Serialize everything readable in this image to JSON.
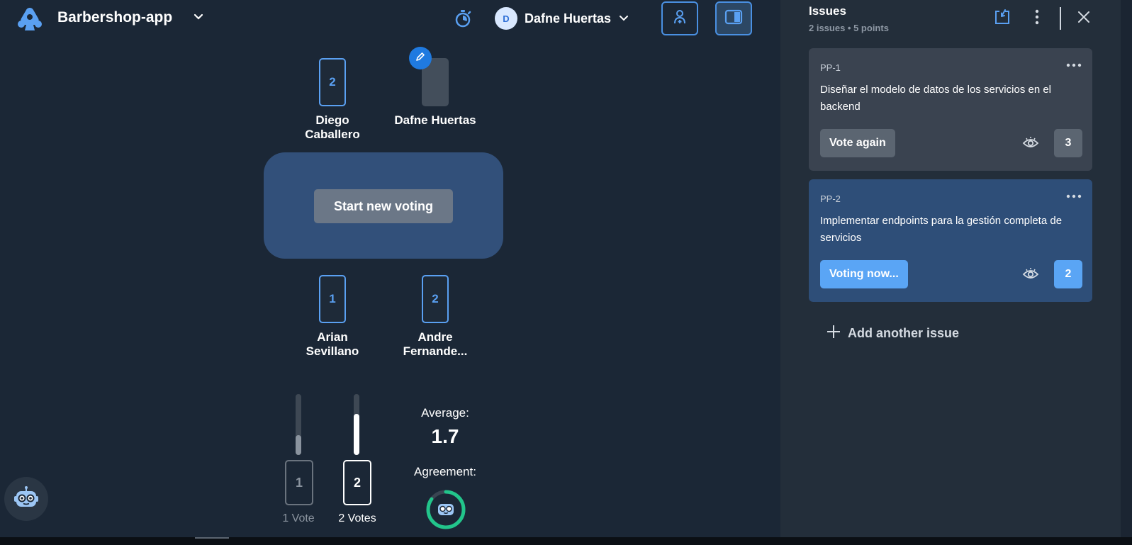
{
  "header": {
    "app_title": "Barbershop-app",
    "user_initial": "D",
    "user_name": "Dafne Huertas"
  },
  "table": {
    "start_label": "Start new voting",
    "players": [
      {
        "name": "Diego Caballero",
        "card": "2",
        "state": "voted"
      },
      {
        "name": "Dafne Huertas",
        "card": "",
        "state": "blank"
      },
      {
        "name": "Arian Sevillano",
        "card": "1",
        "state": "voted"
      },
      {
        "name": "Andre Fernande...",
        "card": "2",
        "state": "voted"
      }
    ]
  },
  "results": {
    "distribution": [
      {
        "card": "1",
        "label": "1 Vote",
        "share": 0.33
      },
      {
        "card": "2",
        "label": "2 Votes",
        "share": 0.67
      }
    ],
    "average_label": "Average:",
    "average_value": "1.7",
    "agreement_label": "Agreement:",
    "agreement_ratio": 0.85
  },
  "sidebar": {
    "title": "Issues",
    "subtitle": "2 issues • 5 points",
    "issues": [
      {
        "key": "PP-1",
        "title": "Diseñar el modelo de datos de los servicios en el backend",
        "action": "Vote again",
        "points": "3"
      },
      {
        "key": "PP-2",
        "title": "Implementar endpoints para la gestión completa de servicios",
        "action": "Voting now...",
        "points": "2"
      }
    ],
    "add_label": "Add another issue"
  },
  "colors": {
    "background": "#1b2736",
    "sidebar": "#232e3a",
    "accent": "#4a90e2",
    "active_issue": "#2e4e78",
    "agreement_ring": "#22c58b"
  },
  "icons": [
    "logo-icon",
    "chevron-down-icon",
    "timer-icon",
    "invite-player-icon",
    "toggle-sidebar-icon",
    "pencil-icon",
    "bot-icon",
    "import-icon",
    "more-vertical-icon",
    "close-icon",
    "more-horizontal-icon",
    "eye-icon",
    "plus-icon"
  ]
}
